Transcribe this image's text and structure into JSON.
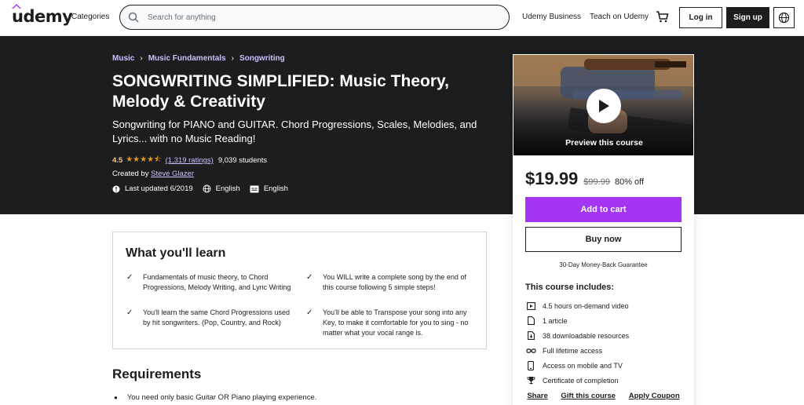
{
  "header": {
    "logo": "udemy",
    "categories": "Categories",
    "search_placeholder": "Search for anything",
    "business": "Udemy Business",
    "teach": "Teach on Udemy",
    "login": "Log in",
    "signup": "Sign up"
  },
  "breadcrumbs": [
    "Music",
    "Music Fundamentals",
    "Songwriting"
  ],
  "course": {
    "title": "SONGWRITING SIMPLIFIED: Music Theory, Melody & Creativity",
    "subtitle": "Songwriting for PIANO and GUITAR. Chord Progressions, Scales, Melodies, and Lyrics... with no Music Reading!",
    "rating": "4.5",
    "stars": "★★★★⯪",
    "ratings_count": "(1,319 ratings)",
    "students": "9,039 students",
    "created_by_label": "Created by",
    "instructor": "Steve Glazer",
    "last_updated": "Last updated 6/2019",
    "language": "English",
    "captions": "English"
  },
  "sidebar": {
    "preview_label": "Preview this course",
    "price": "$19.99",
    "original_price": "$99.99",
    "discount": "80% off",
    "add_to_cart": "Add to cart",
    "buy_now": "Buy now",
    "guarantee": "30-Day Money-Back Guarantee",
    "includes_title": "This course includes:",
    "includes": [
      {
        "icon": "video-icon",
        "text": "4.5 hours on-demand video"
      },
      {
        "icon": "file-icon",
        "text": "1 article"
      },
      {
        "icon": "download-file-icon",
        "text": "38 downloadable resources"
      },
      {
        "icon": "infinity-icon",
        "text": "Full lifetime access"
      },
      {
        "icon": "mobile-icon",
        "text": "Access on mobile and TV"
      },
      {
        "icon": "trophy-icon",
        "text": "Certificate of completion"
      }
    ],
    "links": [
      "Share",
      "Gift this course",
      "Apply Coupon"
    ]
  },
  "learn": {
    "title": "What you'll learn",
    "items": [
      "Fundamentals of music theory, to Chord Progressions, Melody Writing, and Lyric Writing",
      "You WILL write a complete song by the end of this course following 5 simple steps!",
      "You'll learn the same Chord Progressions used by hit songwriters. (Pop, Country, and Rock)",
      "You'll be able to Transpose your song into any Key, to make it comfortable for you to sing - no matter what your vocal range is."
    ]
  },
  "requirements": {
    "title": "Requirements",
    "items": [
      "You need only basic Guitar OR Piano playing experience."
    ]
  },
  "colors": {
    "hero_bg": "#1c1d1f",
    "accent_purple": "#a435f0",
    "link_purple": "#cec0fc",
    "star": "#e59819"
  }
}
